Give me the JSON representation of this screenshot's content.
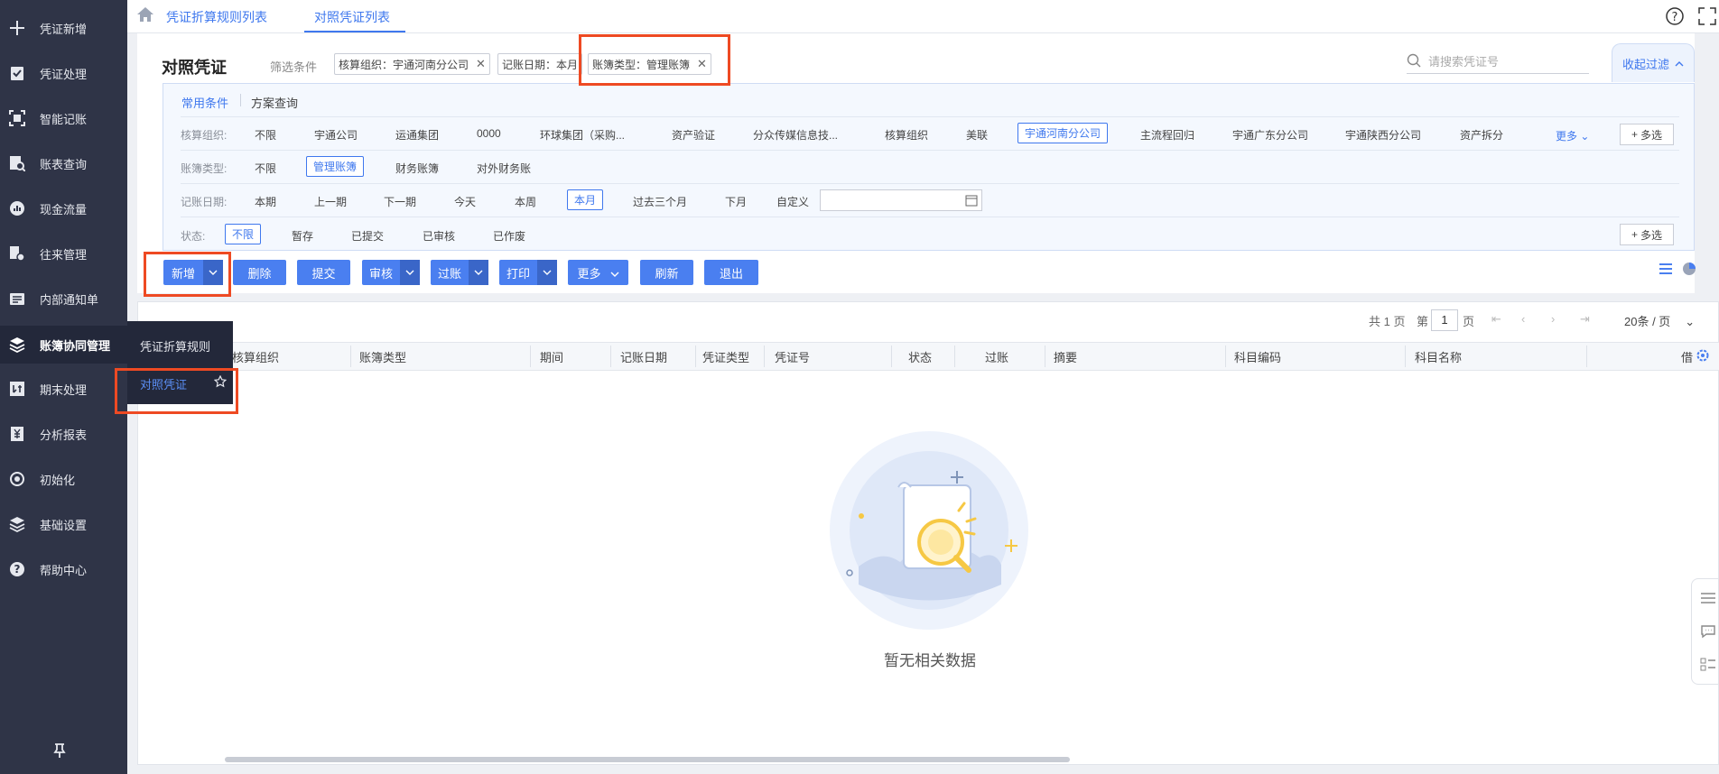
{
  "sidebar": {
    "items": [
      {
        "label": "凭证新增",
        "icon": "plus-icon"
      },
      {
        "label": "凭证处理",
        "icon": "clipboard-check-icon"
      },
      {
        "label": "智能记账",
        "icon": "scan-icon"
      },
      {
        "label": "账表查询",
        "icon": "search-report-icon"
      },
      {
        "label": "现金流量",
        "icon": "chart-circle-icon"
      },
      {
        "label": "往来管理",
        "icon": "transfer-icon"
      },
      {
        "label": "内部通知单",
        "icon": "notice-icon"
      },
      {
        "label": "账簿协同管理",
        "icon": "layers-icon"
      },
      {
        "label": "期末处理",
        "icon": "period-close-icon"
      },
      {
        "label": "分析报表",
        "icon": "yuan-report-icon"
      },
      {
        "label": "初始化",
        "icon": "init-icon"
      },
      {
        "label": "基础设置",
        "icon": "settings-stack-icon"
      },
      {
        "label": "帮助中心",
        "icon": "help-icon"
      }
    ],
    "flyout": {
      "item1": "凭证折算规则",
      "item2": "对照凭证"
    }
  },
  "tabs": [
    {
      "label": "凭证折算规则列表"
    },
    {
      "label": "对照凭证列表"
    }
  ],
  "header": {
    "title": "对照凭证",
    "filter_label": "筛选条件",
    "chips": [
      "核算组织：宇通河南分公司",
      "记账日期：本月",
      "账簿类型：管理账簿"
    ],
    "search_placeholder": "请搜索凭证号",
    "collapse_label": "收起过滤"
  },
  "filter_panel": {
    "tab_common": "常用条件",
    "tab_scheme": "方案查询",
    "org": {
      "label": "核算组织:",
      "options": [
        "不限",
        "宇通公司",
        "运通集团",
        "0000",
        "环球集团（采购...",
        "资产验证",
        "分众传媒信息技...",
        "核算组织",
        "美联",
        "宇通河南分公司",
        "主流程回归",
        "宇通广东分公司",
        "宇通陕西分公司",
        "资产拆分"
      ],
      "more": "更多",
      "multi": "多选"
    },
    "book_type": {
      "label": "账簿类型:",
      "options": [
        "不限",
        "管理账簿",
        "财务账簿",
        "对外财务账"
      ]
    },
    "date": {
      "label": "记账日期:",
      "options": [
        "本期",
        "上一期",
        "下一期",
        "今天",
        "本周",
        "本月",
        "过去三个月",
        "下月",
        "自定义"
      ]
    },
    "status": {
      "label": "状态:",
      "options": [
        "不限",
        "暂存",
        "已提交",
        "已审核",
        "已作废"
      ],
      "multi": "多选"
    }
  },
  "toolbar": {
    "new": "新增",
    "delete": "删除",
    "submit": "提交",
    "audit": "审核",
    "post": "过账",
    "print": "打印",
    "more": "更多",
    "refresh": "刷新",
    "exit": "退出"
  },
  "pager": {
    "total": "共 1 页",
    "page_prefix": "第",
    "page": "1",
    "page_suffix": "页",
    "size": "20条 / 页"
  },
  "table": {
    "columns": [
      "核算组织",
      "账簿类型",
      "期间",
      "记账日期",
      "凭证类型",
      "凭证号",
      "状态",
      "过账",
      "摘要",
      "科目编码",
      "科目名称",
      "借"
    ]
  },
  "empty_text": "暂无相关数据",
  "colors": {
    "accent": "#3f78ee",
    "sidebar": "#2f3447",
    "highlight_box": "#ee4a23"
  }
}
